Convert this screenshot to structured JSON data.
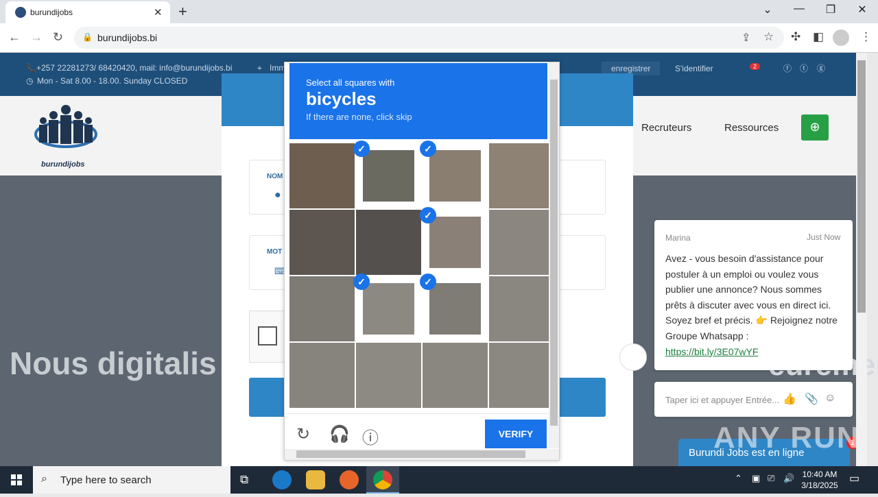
{
  "browser": {
    "tab_title": "burundijobs",
    "url": "burundijobs.bi"
  },
  "site": {
    "contact": "+257 22281273/ 68420420, mail: info@burundijobs.bi",
    "address_fragment": "Imm",
    "hours": "Mon - Sat 8.00 - 18.00. Sunday CLOSED",
    "register": "enregistrer",
    "login": "S'identifier",
    "notif_count": "2",
    "logo_text": "burundijobs",
    "nav": [
      "Recruteurs",
      "Ressources"
    ],
    "hero_text": "Nous digitalis",
    "hero_text_right": "eurement",
    "field_user_label": "NOM",
    "field_pass_label": "MOT"
  },
  "captcha": {
    "instruction": "Select all squares with",
    "target": "bicycles",
    "hint": "If there are none, click skip",
    "verify": "VERIFY",
    "tiles": [
      {
        "selected": false,
        "color": "#6e5e4f"
      },
      {
        "selected": true,
        "color": "#6b6a60"
      },
      {
        "selected": true,
        "color": "#8a7e70"
      },
      {
        "selected": false,
        "color": "#8d8273"
      },
      {
        "selected": false,
        "color": "#5c5550"
      },
      {
        "selected": false,
        "color": "#54504e"
      },
      {
        "selected": true,
        "color": "#8a8078"
      },
      {
        "selected": false,
        "color": "#8b8780"
      },
      {
        "selected": false,
        "color": "#7e7a74"
      },
      {
        "selected": true,
        "color": "#8c8983"
      },
      {
        "selected": true,
        "color": "#7f7b75"
      },
      {
        "selected": false,
        "color": "#8a8680"
      },
      {
        "selected": false,
        "color": "#87837d"
      },
      {
        "selected": false,
        "color": "#8d8983"
      },
      {
        "selected": false,
        "color": "#8a8680"
      },
      {
        "selected": false,
        "color": "#8b8781"
      }
    ]
  },
  "chat": {
    "agent": "Marina",
    "time": "Just Now",
    "message": "Avez - vous besoin d'assistance pour postuler à un emploi ou voulez vous publier une annonce? Nous sommes prêts à discuter avec vous en direct ici. Soyez bref et précis. 👉 Rejoignez notre Groupe Whatsapp :",
    "link": "https://bit.ly/3E07wYF",
    "input_placeholder": "Taper ici et appuyer Entrée...",
    "status_bar": "Burundi Jobs est en ligne",
    "badge": "1"
  },
  "watermark": "ANY RUN",
  "taskbar": {
    "search_placeholder": "Type here to search",
    "time": "10:40 AM",
    "date": "3/18/2025"
  }
}
